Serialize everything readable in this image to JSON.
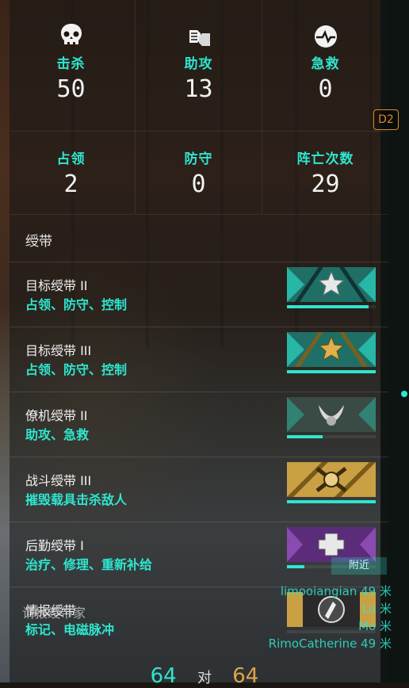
{
  "stats": [
    {
      "label": "击杀",
      "value": "50",
      "icon": "skull-icon"
    },
    {
      "label": "助攻",
      "value": "13",
      "icon": "fist-bump-icon"
    },
    {
      "label": "急救",
      "value": "0",
      "icon": "heartbeat-icon"
    },
    {
      "label": "占领",
      "value": "2",
      "icon": ""
    },
    {
      "label": "防守",
      "value": "0",
      "icon": ""
    },
    {
      "label": "阵亡次数",
      "value": "29",
      "icon": ""
    }
  ],
  "side_tag": "D2",
  "ribbons_title": "绶带",
  "ribbons": [
    {
      "name": "目标绶带 II",
      "desc": "占领、防守、控制",
      "progress": 0.92,
      "icon": "silver-star-ribbon-icon"
    },
    {
      "name": "目标绶带 III",
      "desc": "占领、防守、控制",
      "progress": 1.0,
      "icon": "gold-star-ribbon-icon"
    },
    {
      "name": "僚机绶带 II",
      "desc": "助攻、急救",
      "progress": 0.4,
      "icon": "wingman-ribbon-icon"
    },
    {
      "name": "战斗绶带 III",
      "desc": "摧毁载具击杀敌人",
      "progress": 1.0,
      "icon": "combat-ribbon-icon"
    },
    {
      "name": "后勤绶带 I",
      "desc": "治疗、修理、重新补给",
      "progress": 0.2,
      "icon": "logistics-ribbon-icon"
    },
    {
      "name": "情报绶带",
      "desc": "标记、电磁脉冲",
      "progress": 0.0,
      "icon": "intel-ribbon-icon"
    }
  ],
  "ghost_text": "请报绶带家",
  "nearby_label": "附近",
  "nearby_players": [
    "limooiangian 49 米",
    "Lu 米",
    "Mo 米",
    "RimoCatherine 49 米"
  ],
  "score": {
    "team_a": "64",
    "vs": "对",
    "team_b": "64"
  },
  "colors": {
    "accent": "#2ee6d0",
    "enemy": "#e0a545"
  }
}
